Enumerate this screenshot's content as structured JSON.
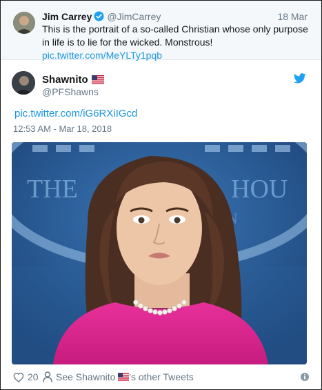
{
  "quoted_tweet": {
    "name": "Jim Carrey",
    "handle": "@JimCarrey",
    "date": "18 Mar",
    "text": "This is the portrait of a so-called Christian whose only purpose in life is to lie for the wicked. Monstrous!",
    "link": "pic.twitter.com/MeYLTy1pqb",
    "verified_color": "#1da1f2"
  },
  "tweet": {
    "name": "Shawnito",
    "handle": "@PFShawns",
    "link": "pic.twitter.com/iG6RXiIGcd",
    "timestamp": "12:53 AM - Mar 18, 2018",
    "photo_sign_text_left": "THE",
    "photo_sign_text_right": "HOU",
    "photo_sign_text_mid": "ON"
  },
  "footer": {
    "likes": "20",
    "other_prefix": "See Shawnito",
    "other_suffix": "'s other Tweets"
  },
  "colors": {
    "link": "#1b95e0",
    "muted": "#657786",
    "twitter_blue": "#1da1f2"
  }
}
